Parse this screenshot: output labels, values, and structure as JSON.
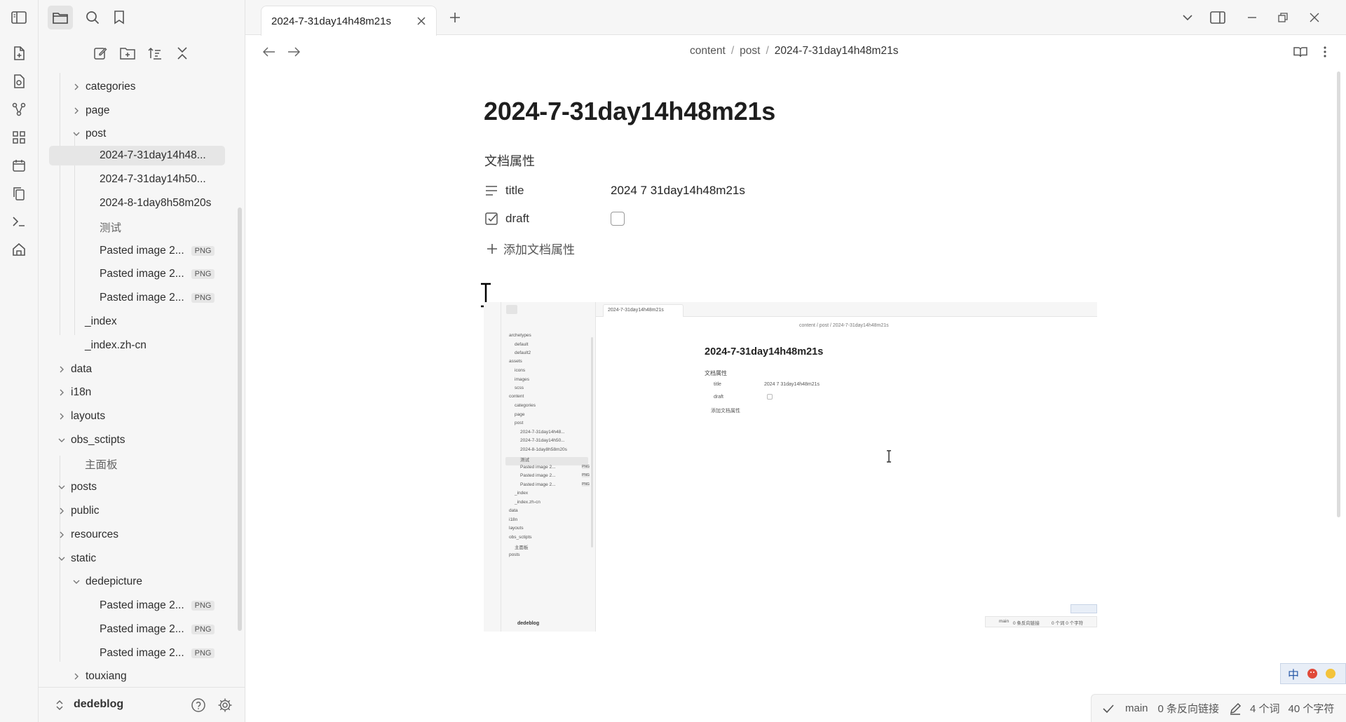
{
  "window": {
    "tab_title": "2024-7-31day14h48m21s"
  },
  "breadcrumb": {
    "parts": [
      "content",
      "post"
    ],
    "current": "2024-7-31day14h48m21s"
  },
  "tree": [
    {
      "label": "categories",
      "type": "folder",
      "expanded": false
    },
    {
      "label": "page",
      "type": "folder",
      "expanded": false
    },
    {
      "label": "post",
      "type": "folder",
      "expanded": true
    },
    {
      "label": "2024-7-31day14h48...",
      "type": "file",
      "selected": true
    },
    {
      "label": "2024-7-31day14h50...",
      "type": "file"
    },
    {
      "label": "2024-8-1day8h58m20s",
      "type": "file"
    },
    {
      "label": "测试",
      "type": "file"
    },
    {
      "label": "Pasted image 2...",
      "type": "file",
      "tag": "PNG"
    },
    {
      "label": "Pasted image 2...",
      "type": "file",
      "tag": "PNG"
    },
    {
      "label": "Pasted image 2...",
      "type": "file",
      "tag": "PNG"
    },
    {
      "label": "_index",
      "type": "file"
    },
    {
      "label": "_index.zh-cn",
      "type": "file"
    },
    {
      "label": "data",
      "type": "folder",
      "expanded": false
    },
    {
      "label": "i18n",
      "type": "folder",
      "expanded": false
    },
    {
      "label": "layouts",
      "type": "folder",
      "expanded": false
    },
    {
      "label": "obs_sctipts",
      "type": "folder",
      "expanded": true
    },
    {
      "label": "主面板",
      "type": "file"
    },
    {
      "label": "posts",
      "type": "folder",
      "expanded": true
    },
    {
      "label": "public",
      "type": "folder",
      "expanded": false
    },
    {
      "label": "resources",
      "type": "folder",
      "expanded": false
    },
    {
      "label": "static",
      "type": "folder",
      "expanded": true
    },
    {
      "label": "dedepicture",
      "type": "folder",
      "expanded": true
    },
    {
      "label": "Pasted image 2...",
      "type": "file",
      "tag": "PNG"
    },
    {
      "label": "Pasted image 2...",
      "type": "file",
      "tag": "PNG"
    },
    {
      "label": "Pasted image 2...",
      "type": "file",
      "tag": "PNG"
    },
    {
      "label": "touxiang",
      "type": "folder",
      "expanded": false
    }
  ],
  "vault": {
    "name": "dedeblog"
  },
  "document": {
    "title": "2024-7-31day14h48m21s",
    "properties_heading": "文档属性",
    "properties": [
      {
        "key": "title",
        "icon": "text-lines-icon",
        "value": "2024 7 31day14h48m21s"
      },
      {
        "key": "draft",
        "icon": "checkbox-icon",
        "value": "",
        "checked": false
      }
    ],
    "add_property_label": "添加文档属性"
  },
  "embed": {
    "tab_title": "2024-7-31day14h48m21s",
    "breadcrumb": "content / post / 2024-7-31day14h48m21s",
    "doc_title": "2024-7-31day14h48m21s",
    "props_heading": "文档属性",
    "prop_title_key": "title",
    "prop_title_value": "2024 7 31day14h48m21s",
    "prop_draft_key": "draft",
    "add_prop": "添加文档属性",
    "tree": [
      "archetypes",
      "default",
      "default2",
      "assets",
      "icons",
      "images",
      "scss",
      "content",
      "categories",
      "page",
      "post",
      "2024-7-31day14h48...",
      "2024-7-31day14h50...",
      "2024-8-1day8h58m20s",
      "测试",
      "Pasted image 2...",
      "Pasted image 2...",
      "Pasted image 2...",
      "_index",
      "_index.zh-cn",
      "data",
      "i18n",
      "layouts",
      "obs_sctipts",
      "主面板",
      "posts"
    ],
    "tag": "PNG",
    "vault": "dedeblog",
    "status": {
      "branch": "main",
      "backlinks": "0 条反向链接",
      "counts": "0 个词 0 个字符"
    }
  },
  "ime": {
    "mode": "中"
  },
  "statusbar": {
    "branch": "main",
    "backlinks": "0 条反向链接",
    "words": "4 个词",
    "chars": "40 个字符"
  },
  "colors": {
    "accent": "#7c5cd6",
    "selection": "#e6e6e6",
    "sidebar_bg": "#f6f6f6"
  }
}
